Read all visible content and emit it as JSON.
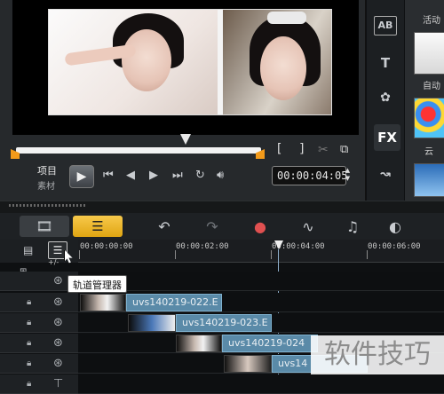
{
  "player": {
    "project_label": "项目",
    "clip_label": "素材",
    "play_icon": "play-icon",
    "timecode": "00:00:04:05",
    "mark_in": "[",
    "mark_out": "]"
  },
  "side_panel": {
    "tabs": [
      "AB",
      "T",
      "FX"
    ],
    "library_labels": [
      "活动",
      "自动",
      "云"
    ]
  },
  "toolbar": {
    "storyboard_icon": "storyboard-view-icon",
    "timeline_icon": "timeline-view-icon",
    "tools": [
      "undo-icon",
      "redo-icon",
      "record-icon",
      "audio-icon",
      "auto-music-icon",
      "motion-track-icon"
    ]
  },
  "ruler": {
    "ticks": [
      "00:00:00:00",
      "00:00:02:00",
      "00:00:04:00",
      "00:00:06:00"
    ],
    "add_remove": "+/-"
  },
  "track_manager": {
    "tooltip": "轨道管理器"
  },
  "tracks": [
    {
      "clips": []
    },
    {
      "clips": [
        "uvs140219-022.E"
      ]
    },
    {
      "clips": [
        "uvs140219-023.E"
      ]
    },
    {
      "clips": [
        "uvs140219-024"
      ]
    },
    {
      "clips": [
        "uvs14"
      ]
    },
    {
      "clips": []
    }
  ],
  "watermark": "软件技巧",
  "colors": {
    "accent": "#f39a1a",
    "timeline_tab": "#e0a512",
    "clip_fill": "#5a8aa8"
  }
}
